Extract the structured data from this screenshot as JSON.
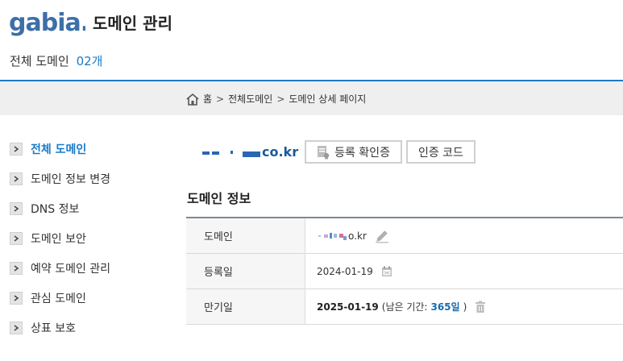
{
  "header": {
    "logo_text": "gabia.",
    "title": "도메인 관리",
    "total_label": "전체 도메인",
    "total_count": "02개"
  },
  "breadcrumb": {
    "home": "홈",
    "sep1": ">",
    "level1": "전체도메인",
    "sep2": ">",
    "level2": "도메인 상세 페이지"
  },
  "sidebar": {
    "items": [
      {
        "label": "전체 도메인",
        "active": true
      },
      {
        "label": "도메인 정보 변경"
      },
      {
        "label": "DNS 정보"
      },
      {
        "label": "도메인 보안"
      },
      {
        "label": "예약 도메인 관리"
      },
      {
        "label": "관심 도메인"
      },
      {
        "label": "상표 보호"
      }
    ]
  },
  "domain_head": {
    "domain_suffix": "co.kr",
    "register_cert_button": "등록 확인증",
    "auth_code_button": "인증 코드"
  },
  "section": {
    "title": "도메인 정보"
  },
  "info": {
    "domain_key": "도메인",
    "domain_value_suffix": "o.kr",
    "registered_key": "등록일",
    "registered_value": "2024-01-19",
    "expiry_key": "만기일",
    "expiry_date": "2025-01-19",
    "remaining_prefix": "(남은 기간:",
    "remaining_days": "365일",
    "remaining_suffix": ")"
  },
  "colors": {
    "accent": "#1a7ac8",
    "rule": "#1a7ac8",
    "breadcrumb_bg": "#efefef"
  },
  "icons": [
    "home-icon",
    "chevron-right-icon",
    "certificate-icon",
    "edit-pencil-icon",
    "calendar-icon",
    "trash-icon"
  ]
}
